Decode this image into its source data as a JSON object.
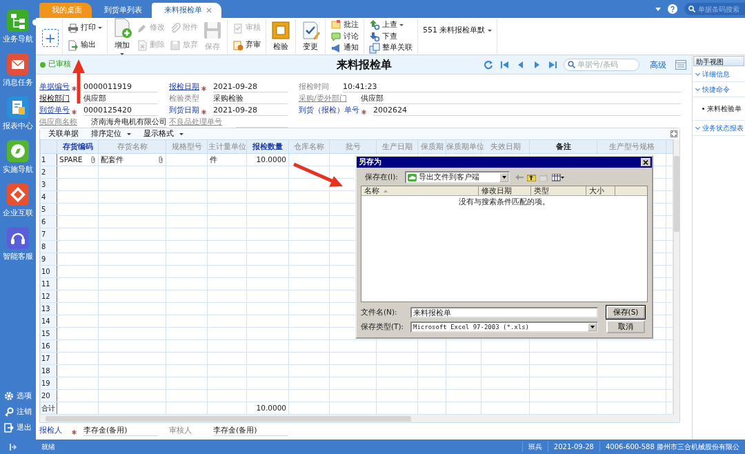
{
  "sidebar": {
    "items": [
      {
        "label": "业务导航",
        "dropdown": true
      },
      {
        "label": "消息任务",
        "dropdown": false
      },
      {
        "label": "报表中心",
        "dropdown": false
      },
      {
        "label": "实施导航",
        "dropdown": false
      },
      {
        "label": "企业互联",
        "dropdown": false
      },
      {
        "label": "智能客服",
        "dropdown": false
      }
    ],
    "footer_items": [
      {
        "label": "选项"
      },
      {
        "label": "注销"
      },
      {
        "label": "退出"
      }
    ]
  },
  "tabs": [
    {
      "label": "我的桌面",
      "kind": "home",
      "selected": false,
      "closable": false
    },
    {
      "label": "到货单列表",
      "kind": "page",
      "selected": false,
      "closable": false
    },
    {
      "label": "来料报检单",
      "kind": "page",
      "selected": true,
      "closable": true
    }
  ],
  "global_search": {
    "placeholder": "单据条码搜索"
  },
  "toolbar": [
    {
      "columns": [
        [
          {
            "kind": "add",
            "label": "+"
          }
        ]
      ]
    },
    {
      "columns": [
        [
          {
            "kind": "small",
            "label": "打印",
            "disabled": false,
            "dropdown": true
          },
          {
            "kind": "small",
            "label": "输出",
            "disabled": false,
            "dropdown": false
          }
        ]
      ]
    },
    {
      "columns": [
        [
          {
            "kind": "big",
            "label": "增加",
            "disabled": false,
            "dropdown": true
          }
        ],
        [
          {
            "kind": "small",
            "label": "修改",
            "disabled": true,
            "dropdown": false
          },
          {
            "kind": "small",
            "label": "删除",
            "disabled": true,
            "dropdown": false
          }
        ],
        [
          {
            "kind": "small",
            "label": "附件",
            "disabled": true,
            "dropdown": false
          },
          {
            "kind": "small",
            "label": "放弃",
            "disabled": true,
            "dropdown": false
          }
        ],
        [
          {
            "kind": "big",
            "label": "保存",
            "disabled": true,
            "dropdown": false
          }
        ]
      ]
    },
    {
      "columns": [
        [
          {
            "kind": "small",
            "label": "审核",
            "disabled": true,
            "dropdown": false
          },
          {
            "kind": "small",
            "label": "弃审",
            "disabled": false,
            "dropdown": false
          }
        ]
      ]
    },
    {
      "columns": [
        [
          {
            "kind": "big",
            "label": "检验",
            "disabled": false,
            "dropdown": false
          }
        ]
      ]
    },
    {
      "columns": [
        [
          {
            "kind": "big",
            "label": "变更",
            "disabled": false,
            "dropdown": false
          }
        ]
      ]
    },
    {
      "columns": [
        [
          {
            "kind": "small",
            "label": "批注",
            "disabled": false,
            "dropdown": false
          },
          {
            "kind": "small",
            "label": "讨论",
            "disabled": false,
            "dropdown": false
          },
          {
            "kind": "small",
            "label": "通知",
            "disabled": false,
            "dropdown": false
          }
        ]
      ]
    },
    {
      "columns": [
        [
          {
            "kind": "small",
            "label": "上查",
            "disabled": false,
            "dropdown": true
          },
          {
            "kind": "small",
            "label": "下查",
            "disabled": false,
            "dropdown": false
          },
          {
            "kind": "small",
            "label": "整单关联",
            "disabled": false,
            "dropdown": false
          }
        ]
      ]
    },
    {
      "columns": [
        [
          {
            "kind": "select",
            "label": "551 来料报检单默",
            "dropdown": true
          }
        ]
      ]
    }
  ],
  "doc": {
    "status": {
      "label": "已审核",
      "kind": "approved"
    },
    "title": "来料报检单",
    "search": {
      "placeholder": "单据号/条码"
    },
    "advanced_link": "高级"
  },
  "fields": [
    {
      "label": "单据编号",
      "kind": "primary",
      "link": true,
      "required": true,
      "value": "0000011919"
    },
    {
      "label": "报检日期",
      "kind": "primary",
      "link": true,
      "required": true,
      "value": "2021-09-28"
    },
    {
      "label": "报检时间",
      "kind": "muted",
      "link": false,
      "required": false,
      "value": "10:41:23"
    },
    {
      "label": "报检部门",
      "kind": "plain",
      "link": true,
      "required": false,
      "value": "供应部"
    },
    {
      "label": "检验类型",
      "kind": "muted",
      "link": false,
      "required": false,
      "value": "采购检验"
    },
    {
      "label": "采购/委外部门",
      "kind": "muted",
      "link": true,
      "required": false,
      "value": "供应部"
    },
    {
      "label": "到货单号",
      "kind": "primary",
      "link": true,
      "required": true,
      "value": "0000125420"
    },
    {
      "label": "到货日期",
      "kind": "primary",
      "link": false,
      "required": true,
      "value": "2021-09-28"
    },
    {
      "label": "到货（报检）单号",
      "kind": "primary",
      "link": false,
      "required": true,
      "value": "2002624"
    },
    {
      "label": "供应商名称",
      "kind": "muted",
      "link": true,
      "required": false,
      "value": "济南海舟电机有限公司"
    },
    {
      "label": "不良品处理单号",
      "kind": "muted",
      "link": true,
      "required": false
    }
  ],
  "grid_toolbar": [
    {
      "label": "关联单据",
      "dropdown": false
    },
    {
      "label": "排序定位",
      "dropdown": true
    },
    {
      "label": "显示格式",
      "dropdown": true
    }
  ],
  "table": {
    "columns": [
      {
        "label": "存货编码",
        "kind": "required"
      },
      {
        "label": "存货名称",
        "kind": "normal"
      },
      {
        "label": "规格型号",
        "kind": "normal"
      },
      {
        "label": "主计量单位",
        "kind": "normal"
      },
      {
        "label": "报检数量",
        "kind": "required"
      },
      {
        "label": "仓库名称",
        "kind": "normal"
      },
      {
        "label": "批号",
        "kind": "normal"
      },
      {
        "label": "生产日期",
        "kind": "normal"
      },
      {
        "label": "保质期",
        "kind": "normal"
      },
      {
        "label": "保质期单位",
        "kind": "normal"
      },
      {
        "label": "失效日期",
        "kind": "normal"
      },
      {
        "label": "备注",
        "kind": "bold"
      },
      {
        "label": "生产型号规格",
        "kind": "normal"
      }
    ],
    "rows": [
      {
        "no": "1",
        "cells": [
          {
            "text": "SPARE",
            "attachment": true
          },
          {
            "text": "配套件",
            "attachment": true
          },
          null,
          {
            "text": "件",
            "attachment": false
          },
          {
            "text": "10.0000",
            "attachment": false
          }
        ]
      },
      {
        "no": "2"
      },
      {
        "no": "3"
      },
      {
        "no": "4"
      },
      {
        "no": "5"
      },
      {
        "no": "6"
      },
      {
        "no": "7"
      },
      {
        "no": "8"
      },
      {
        "no": "9"
      },
      {
        "no": "10"
      },
      {
        "no": "11"
      },
      {
        "no": "12"
      },
      {
        "no": "13"
      },
      {
        "no": "14"
      },
      {
        "no": "15"
      },
      {
        "no": "16"
      },
      {
        "no": "17"
      },
      {
        "no": "18"
      },
      {
        "no": "19"
      },
      {
        "no": "20"
      }
    ],
    "total": {
      "label": "合计",
      "cells": [
        null,
        null,
        null,
        null,
        {
          "text": "10.0000",
          "attachment": false
        }
      ]
    }
  },
  "footer_fields": [
    {
      "label": "报检人",
      "kind": "primary",
      "required": true,
      "value": "李存金(备用)"
    },
    {
      "label": "审核人",
      "kind": "muted",
      "required": false,
      "value": "李存金(备用)"
    }
  ],
  "assistant": {
    "title": "助手视图",
    "sections": [
      {
        "label": "详细信息"
      },
      {
        "label": "快捷命令",
        "items": [
          "来料检验单"
        ]
      },
      {
        "label": "业务状态报表"
      }
    ]
  },
  "save_dialog": {
    "title": "另存为",
    "location_label": "保存在(I):",
    "location": "导出文件到客户端",
    "columns": [
      {
        "label": "名称",
        "sorted": true
      },
      {
        "label": "修改日期",
        "sorted": false
      },
      {
        "label": "类型",
        "sorted": false
      },
      {
        "label": "大小",
        "sorted": false
      }
    ],
    "empty_message": "没有与搜索条件匹配的项。",
    "filename_label": "文件名(N):",
    "filename": "来料报检单",
    "filetype_label": "保存类型(T):",
    "filetype": "Microsoft Excel 97-2003 (*.xls)",
    "buttons": [
      {
        "label": "保存(S)",
        "default": true
      },
      {
        "label": "取消",
        "default": false
      }
    ]
  },
  "status_bar": {
    "text": "就绪",
    "cells": [
      "班兵",
      "2021-09-28",
      "4006-600-588 滕州市三合机械股份有限公"
    ]
  }
}
